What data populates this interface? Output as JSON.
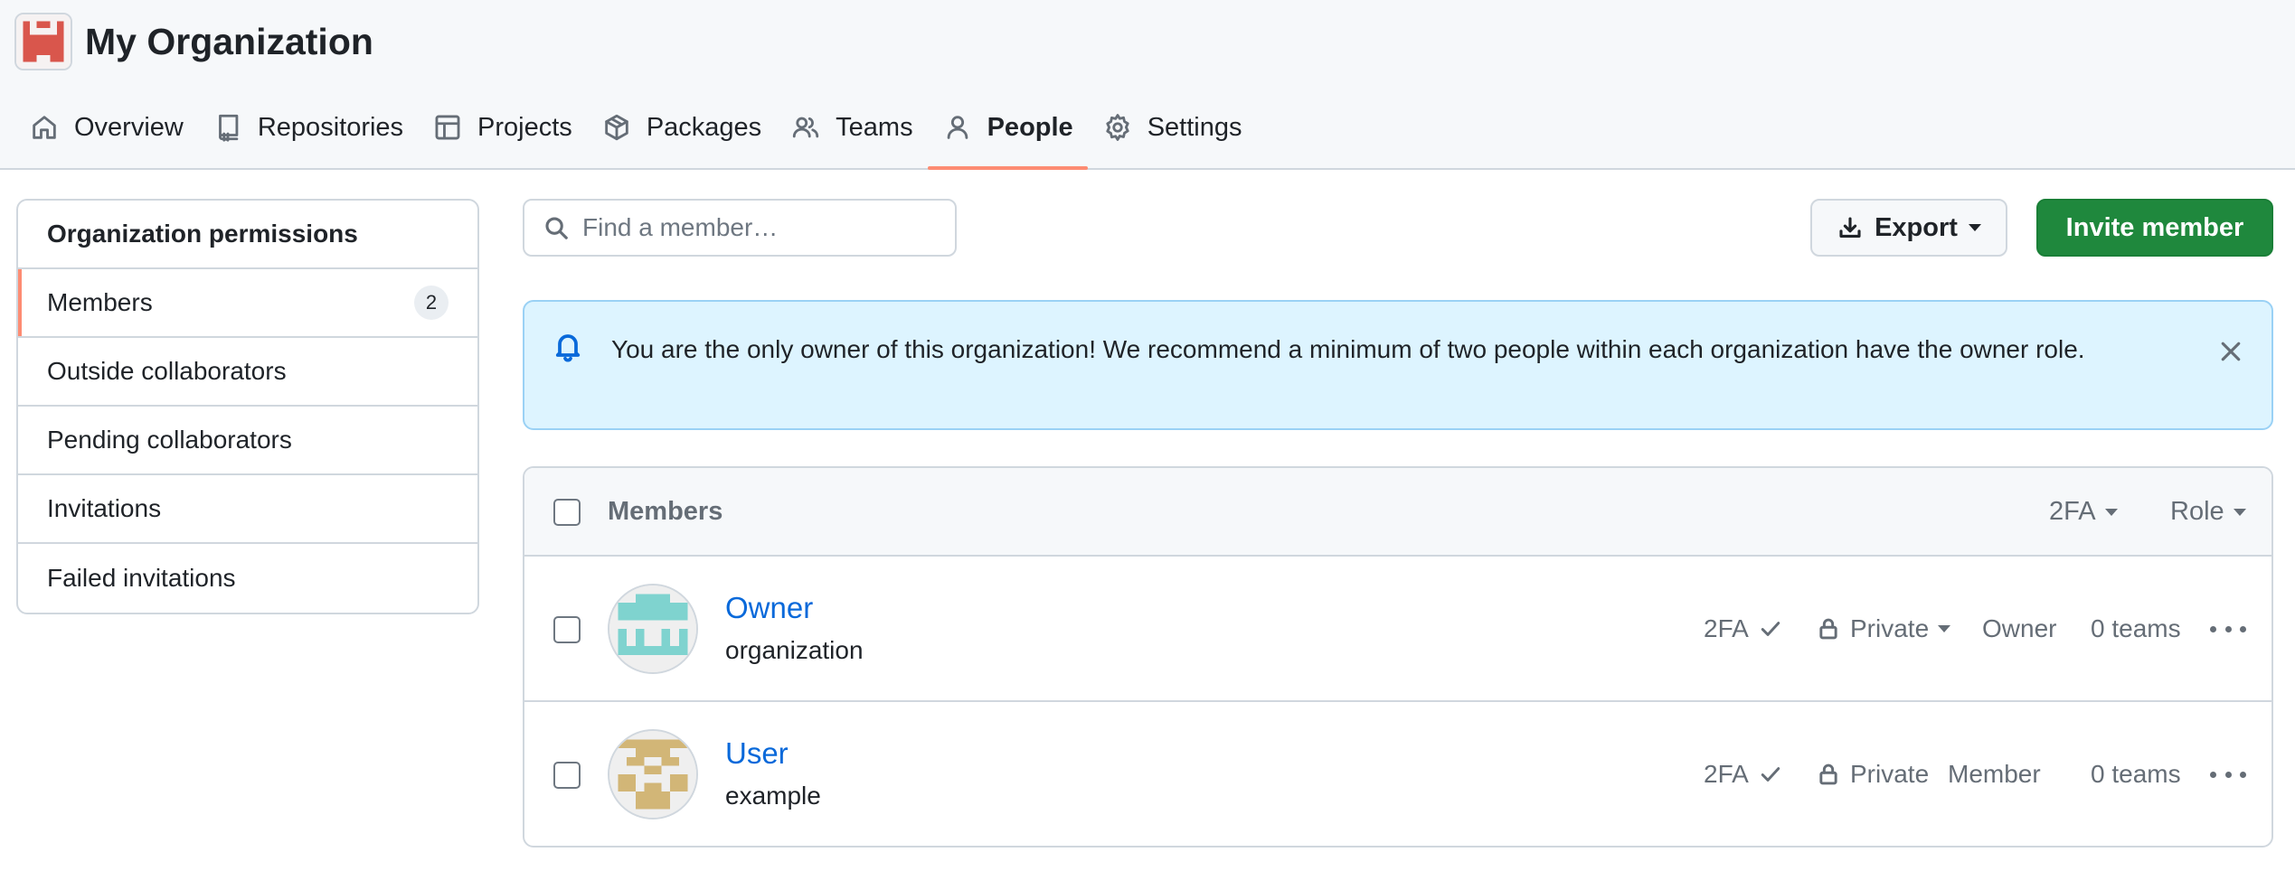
{
  "header": {
    "org_name": "My Organization",
    "accent_color": "#fd8c73",
    "tabs": [
      {
        "label": "Overview",
        "icon": "home-icon"
      },
      {
        "label": "Repositories",
        "icon": "repo-icon"
      },
      {
        "label": "Projects",
        "icon": "table-icon"
      },
      {
        "label": "Packages",
        "icon": "package-icon"
      },
      {
        "label": "Teams",
        "icon": "people-icon"
      },
      {
        "label": "People",
        "icon": "person-icon",
        "selected": true
      },
      {
        "label": "Settings",
        "icon": "gear-icon"
      }
    ]
  },
  "sidebar": {
    "heading": "Organization permissions",
    "items": [
      {
        "label": "Members",
        "count": "2",
        "selected": true
      },
      {
        "label": "Outside collaborators"
      },
      {
        "label": "Pending collaborators"
      },
      {
        "label": "Invitations"
      },
      {
        "label": "Failed invitations"
      }
    ]
  },
  "toolbar": {
    "search_placeholder": "Find a member…",
    "search_value": "",
    "export_label": "Export",
    "invite_label": "Invite member",
    "invite_color": "#1f883d"
  },
  "flash": {
    "message": "You are the only owner of this organization! We recommend a minimum of two people within each organization have the owner role."
  },
  "members": {
    "header_label": "Members",
    "filter_2fa": "2FA",
    "filter_role": "Role",
    "rows": [
      {
        "name": "Owner",
        "login": "organization",
        "twofa": "2FA",
        "visibility": "Private",
        "visibility_dropdown": true,
        "role": "Owner",
        "teams": "0 teams",
        "avatar_color": "#7fd3cf"
      },
      {
        "name": "User",
        "login": "example",
        "twofa": "2FA",
        "visibility": "Private",
        "visibility_dropdown": false,
        "role": "Member",
        "teams": "0 teams",
        "avatar_color": "#d2b677"
      }
    ]
  }
}
